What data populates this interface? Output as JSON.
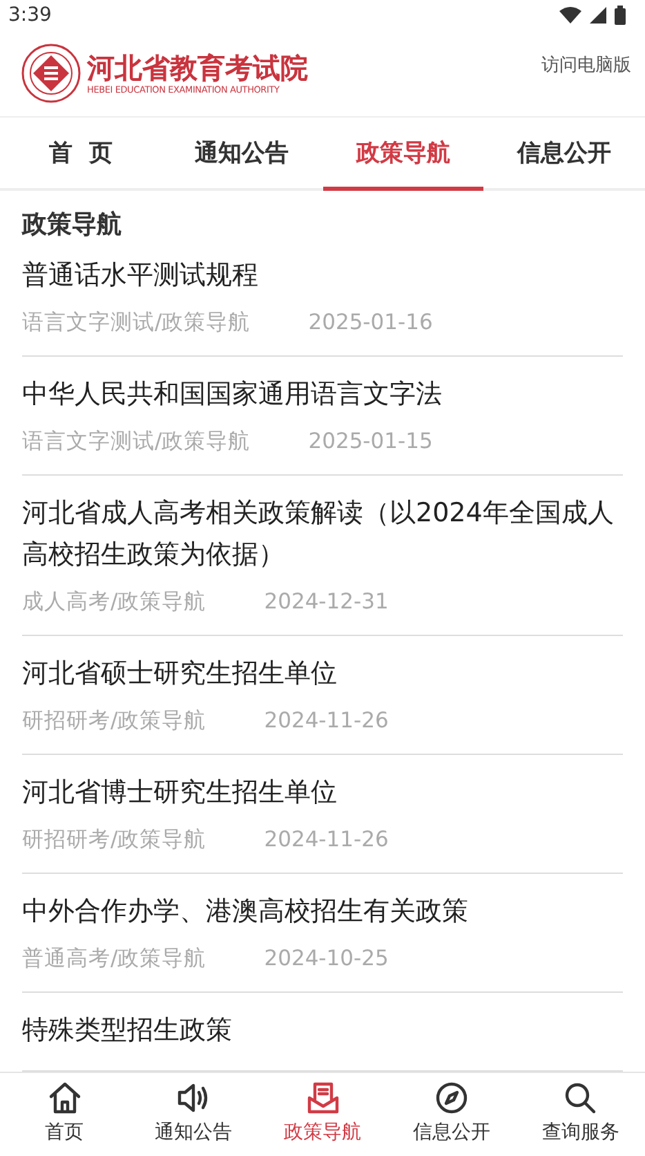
{
  "status_bar": {
    "time": "3:39"
  },
  "header": {
    "logo_title": "河北省教育考试院",
    "logo_subtitle": "HEBEI EDUCATION EXAMINATION AUTHORITY",
    "desktop_link": "访问电脑版"
  },
  "tabs": [
    {
      "label": "首  页",
      "selected": false
    },
    {
      "label": "通知公告",
      "selected": false
    },
    {
      "label": "政策导航",
      "selected": true
    },
    {
      "label": "信息公开",
      "selected": false
    }
  ],
  "section_title": "政策导航",
  "articles": [
    {
      "title": "普通话水平测试规程",
      "category": "语言文字测试/政策导航",
      "date": "2025-01-16"
    },
    {
      "title": "中华人民共和国国家通用语言文字法",
      "category": "语言文字测试/政策导航",
      "date": "2025-01-15"
    },
    {
      "title": "河北省成人高考相关政策解读（以2024年全国成人高校招生政策为依据）",
      "category": "成人高考/政策导航",
      "date": "2024-12-31"
    },
    {
      "title": "河北省硕士研究生招生单位",
      "category": "研招研考/政策导航",
      "date": "2024-11-26"
    },
    {
      "title": "河北省博士研究生招生单位",
      "category": "研招研考/政策导航",
      "date": "2024-11-26"
    },
    {
      "title": "中外合作办学、港澳高校招生有关政策",
      "category": "普通高考/政策导航",
      "date": "2024-10-25"
    },
    {
      "title": "特殊类型招生政策"
    }
  ],
  "bottom_nav": [
    {
      "label": "首页",
      "selected": false
    },
    {
      "label": "通知公告",
      "selected": false
    },
    {
      "label": "政策导航",
      "selected": true
    },
    {
      "label": "信息公开",
      "selected": false
    },
    {
      "label": "查询服务",
      "selected": false
    }
  ]
}
